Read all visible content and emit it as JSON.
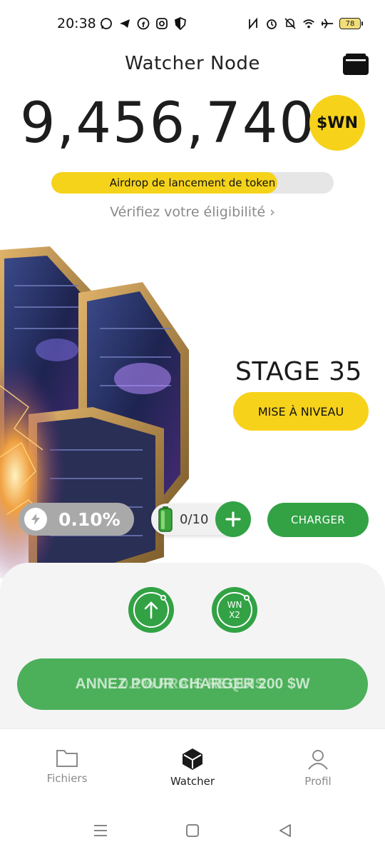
{
  "status_bar": {
    "time": "20:38",
    "battery": "78",
    "icons_left": [
      "whatsapp-icon",
      "telegram-icon",
      "facebook-icon",
      "instagram-icon",
      "shield-icon"
    ],
    "icons_right": [
      "nfc-icon",
      "alarm-icon",
      "mute-icon",
      "wifi-icon",
      "airplane-icon"
    ]
  },
  "header": {
    "title": "Watcher Node",
    "wallet_icon": "wallet-icon"
  },
  "balance": {
    "amount": "9,456,740",
    "token_symbol": "$WN",
    "token_color": "#f6d21a"
  },
  "airdrop": {
    "label": "Airdrop de lancement de token",
    "progress": 0.8,
    "link": "Vérifiez votre éligibilité"
  },
  "stage": {
    "label": "STAGE 35",
    "upgrade_label": "MISE À NIVEAU"
  },
  "mining": {
    "rate": "0.10%",
    "energy": "0/10",
    "charge_label": "CHARGER"
  },
  "actions": {
    "boost_label_line1": "WN",
    "boost_label_line2": "X2",
    "claim_text_a": "ANNEZ POUR CHARGER 200 $W",
    "claim_text_b": "0.1% FRAIS REQUIS"
  },
  "nav": {
    "items": [
      {
        "label": "Fichiers",
        "icon": "folder-icon"
      },
      {
        "label": "Watcher",
        "icon": "cube-icon"
      },
      {
        "label": "Profil",
        "icon": "person-icon"
      }
    ],
    "active_index": 1
  },
  "colors": {
    "accent_yellow": "#f6d21a",
    "accent_green": "#32a245",
    "muted_grey": "#a9a9a9"
  }
}
